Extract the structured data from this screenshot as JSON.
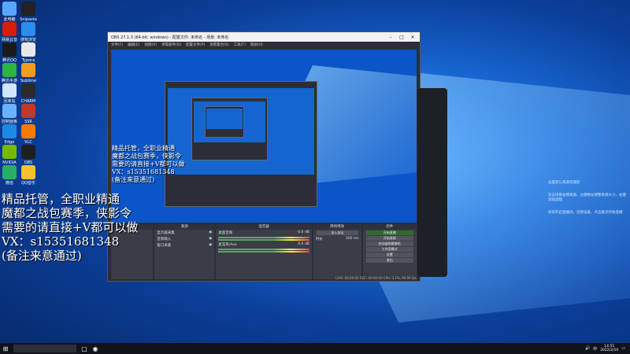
{
  "desktop": {
    "icons": [
      {
        "label": "此电脑",
        "color": "#58a6ff"
      },
      {
        "label": "Snipaste",
        "color": "#222222"
      },
      {
        "label": "网易云音乐",
        "color": "#d81e06"
      },
      {
        "label": "搜狗浏览器",
        "color": "#2d8cf0"
      },
      {
        "label": "腾讯QQ",
        "color": "#1a1a1a"
      },
      {
        "label": "Typora",
        "color": "#e8e8e8"
      },
      {
        "label": "腾讯手游助手",
        "color": "#2fb344"
      },
      {
        "label": "Sublime",
        "color": "#f29d1e"
      },
      {
        "label": "回收站",
        "color": "#cfe4ff"
      },
      {
        "label": "CHARM",
        "color": "#2a2a2a"
      },
      {
        "label": "控制面板",
        "color": "#6ab2ff"
      },
      {
        "label": "SSR",
        "color": "#c0392b"
      },
      {
        "label": "Edge",
        "color": "#1e88e5"
      },
      {
        "label": "VLC",
        "color": "#f57c00"
      },
      {
        "label": "NVIDIA",
        "color": "#76b900"
      },
      {
        "label": "OBS",
        "color": "#1f1f1f"
      },
      {
        "label": "微信",
        "color": "#2aae67"
      },
      {
        "label": "QQ音乐",
        "color": "#f7c12b"
      }
    ]
  },
  "obs": {
    "title": "OBS 27.1.3 (64-bit, windows) - 配置文件: 未命名 - 场景: 未命名",
    "menu": [
      "文件(F)",
      "编辑(E)",
      "视图(V)",
      "停靠部件(D)",
      "配置文件(P)",
      "场景集合(S)",
      "工具(T)",
      "帮助(H)"
    ],
    "docks": {
      "scenes": "场景",
      "sources": "来源",
      "mixer": "混音器",
      "transitions": "转场特效",
      "controls": "控件"
    },
    "sources_items": [
      "显示器采集",
      "音频输入",
      "窗口采集"
    ],
    "mixer_items": [
      {
        "name": "桌面音频",
        "db": "-0.0 dB"
      },
      {
        "name": "麦克风/Aux",
        "db": "0.0 dB"
      }
    ],
    "transition": {
      "name": "淡入淡出",
      "duration_label": "时长",
      "duration": "300 ms"
    },
    "controls_buttons": [
      "开始直播",
      "开始录制",
      "启动虚拟摄像机",
      "工作室模式",
      "设置",
      "退出"
    ],
    "status": "LIVE: 00:00:00  REC: 00:00:00  CPU: 3.1%, 60.00 fps"
  },
  "overlay_text": {
    "big": "精品托管，全职业精通\n魔都之战包赛季，侠影令\n需要的请直接+V都可以做\nVX：s15351681348\n(备注来意通过)",
    "small": "精品托管，全职业精通\n魔都之战包赛季，侠影令\n需要的请直接+V都可以做\nVX：s15351681348\n(备注来意通过)"
  },
  "right_panel": {
    "notes": [
      "设置默认来源或捕获",
      "双击场景右侧来源，左键拖动调整来源大小，右键添加滤镜",
      "如何开启直播间，连接设备，点击推流开始直播"
    ]
  },
  "taskbar": {
    "time": "14:51",
    "date": "2022/2/10",
    "lang": "中"
  }
}
